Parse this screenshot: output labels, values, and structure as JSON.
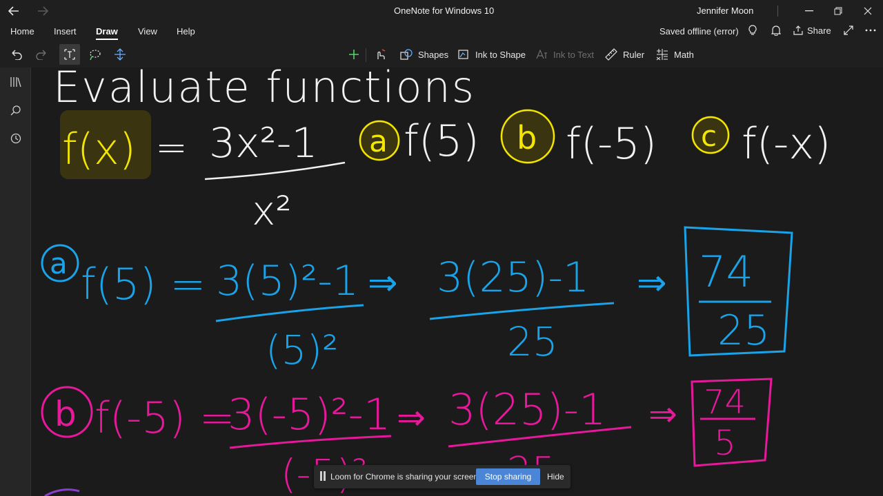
{
  "window": {
    "title": "OneNote for Windows 10",
    "user": "Jennifer Moon"
  },
  "menu": {
    "items": [
      "Home",
      "Insert",
      "Draw",
      "View",
      "Help"
    ],
    "active": "Draw",
    "status": "Saved offline (error)",
    "share_label": "Share"
  },
  "toolbar": {
    "shapes_label": "Shapes",
    "ink_to_shape_label": "Ink to Shape",
    "ink_to_text_label": "Ink to Text",
    "ruler_label": "Ruler",
    "math_label": "Math"
  },
  "pens": [
    {
      "color": "#c050d0",
      "icon": "marker-pen-icon"
    },
    {
      "color": "#ffffff",
      "icon": "pen-icon"
    },
    {
      "color": "#8a3fc9",
      "icon": "pen-icon"
    },
    {
      "color": "#1ea6e6",
      "icon": "pen-icon"
    },
    {
      "color": "#e6e6e6",
      "icon": "pen-icon"
    },
    {
      "color": "#f4e600",
      "icon": "highlighter-icon"
    },
    {
      "color": "#8a3fc9",
      "icon": "pen-icon"
    },
    {
      "color": "#e6199b",
      "icon": "pen-icon"
    }
  ],
  "ink": {
    "title": "Evaluate functions",
    "function": "f(x) = (3x² - 1) / x²",
    "parts": [
      "a",
      "f(5)",
      "b",
      "f(-5)",
      "c",
      "f(-x)"
    ],
    "step_a": {
      "label": "a",
      "lhs": "f(5) =",
      "num": "3(5)²-1",
      "den": "(5)²",
      "mid_num": "3(25)-1",
      "mid_den": "25",
      "ans_num": "74",
      "ans_den": "25"
    },
    "step_b": {
      "label": "b",
      "lhs": "f(-5) =",
      "num": "3(-5)²-1",
      "den": "(-5)²",
      "mid_num": "3(25)-1",
      "mid_den": "25",
      "ans_num": "74",
      "ans_den": "5"
    },
    "colors": {
      "white": "#f2f2f2",
      "yellow": "#f3e600",
      "blue": "#1aa3e8",
      "pink": "#e6199b"
    }
  },
  "loom_bar": {
    "message": "Loom for Chrome is sharing your screen.",
    "stop_label": "Stop sharing",
    "hide_label": "Hide"
  }
}
